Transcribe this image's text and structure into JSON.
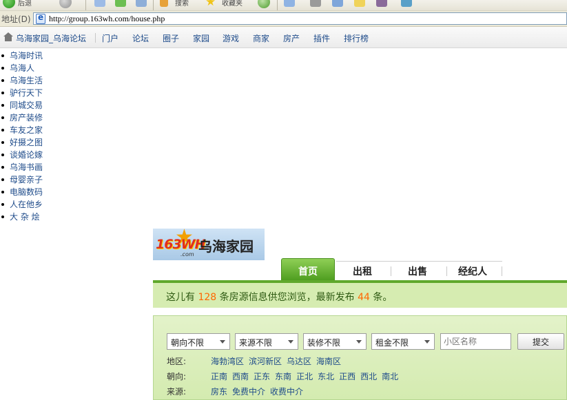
{
  "browser": {
    "toolbar_labels": [
      "后退",
      "搜索",
      "收藏夹"
    ],
    "address_label": "地址(D)",
    "url": "http://group.163wh.com/house.php"
  },
  "site_nav": {
    "home": "乌海家园_乌海论坛",
    "links": [
      "门户",
      "论坛",
      "圈子",
      "家园",
      "游戏",
      "商家",
      "房产",
      "插件",
      "排行榜"
    ]
  },
  "forum_list": [
    "乌海时讯",
    "乌海人",
    "乌海生活",
    "驴行天下",
    "同城交易",
    "房产装修",
    "车友之家",
    "好摄之图",
    "谈婚论嫁",
    "乌海书画",
    "母婴亲子",
    "电脑数码",
    "人在他乡",
    "大 杂 烩"
  ],
  "logo": {
    "mark": "163WH",
    "sub": ".com",
    "name": "乌海家园"
  },
  "tabs": [
    "首页",
    "出租",
    "出售",
    "经纪人"
  ],
  "notice": {
    "prefix": "这儿有",
    "total": "128",
    "middle": "条房源信息供您浏览，最新发布",
    "latest": "44",
    "suffix": "条。"
  },
  "search": {
    "selects": [
      "朝向不限",
      "来源不限",
      "装修不限",
      "租金不限"
    ],
    "estate_placeholder": "小区名称",
    "submit_label": "提交",
    "filters": [
      {
        "label": "地区:",
        "options": [
          "海勃湾区",
          "滨河新区",
          "乌达区",
          "海南区"
        ]
      },
      {
        "label": "朝向:",
        "options": [
          "正南",
          "西南",
          "正东",
          "东南",
          "正北",
          "东北",
          "正西",
          "西北",
          "南北"
        ]
      },
      {
        "label": "来源:",
        "options": [
          "房东",
          "免费中介",
          "收费中介"
        ]
      }
    ]
  }
}
